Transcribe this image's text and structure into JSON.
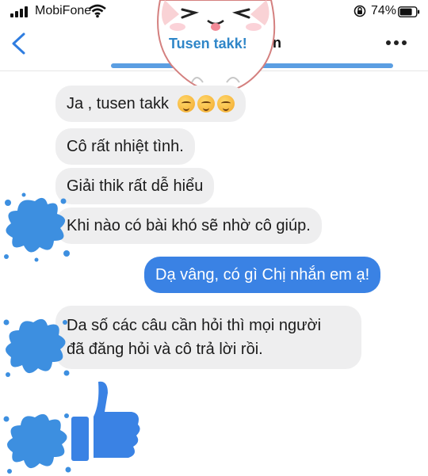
{
  "status_bar": {
    "carrier": "MobiFone",
    "battery_percent": "74%",
    "icons": [
      "signal-icon",
      "wifi-icon",
      "orientation-lock-icon",
      "battery-icon"
    ]
  },
  "nav": {
    "back_icon": "chevron-left-icon",
    "title_fragment": "n",
    "more_icon": "more-dots-icon"
  },
  "sticker": {
    "text": "Tusen takk!"
  },
  "messages": [
    {
      "direction": "in",
      "text": "Ja , tusen takk",
      "emoji": [
        "hugging-face-emoji",
        "hugging-face-emoji",
        "hugging-face-emoji"
      ]
    },
    {
      "direction": "in",
      "text": "Cô rất nhiệt tình."
    },
    {
      "direction": "in",
      "text": "Giải thik rất dễ hiểu"
    },
    {
      "direction": "in",
      "text": "Khi nào có bài khó sẽ nhờ cô giúp."
    },
    {
      "direction": "out",
      "text": "Dạ vâng, có gì Chị nhắn em ạ!"
    },
    {
      "direction": "in",
      "lines": [
        "Da số các câu cần hỏi thì mọi người",
        "đã đăng hỏi và cô trả lời rồi."
      ]
    }
  ],
  "reaction": {
    "icon": "thumbs-up-icon"
  },
  "colors": {
    "incoming_bubble": "#eeeeef",
    "outgoing_bubble": "#3a82e4",
    "accent": "#3e8ddd",
    "splat": "#3d8fe0"
  }
}
